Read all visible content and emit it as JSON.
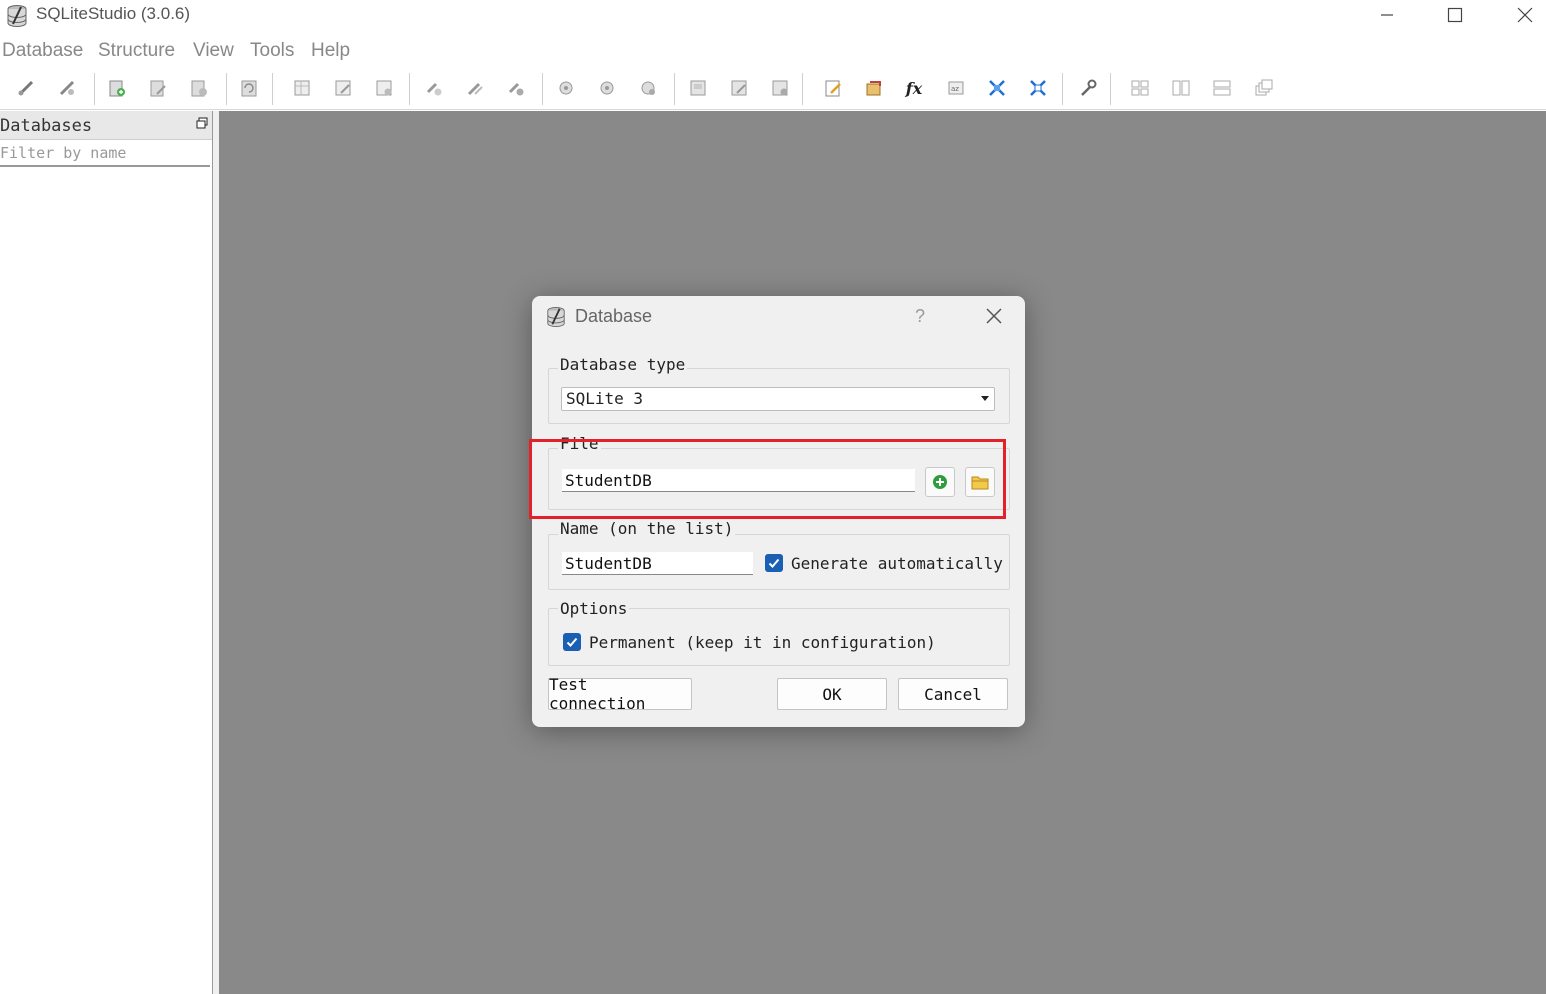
{
  "window": {
    "title": "SQLiteStudio (3.0.6)",
    "icon": "sqlite-database-icon"
  },
  "menu": [
    "Database",
    "Structure",
    "View",
    "Tools",
    "Help"
  ],
  "toolbar": {
    "icons": [
      "connect-icon",
      "disconnect-icon",
      "add-database-icon",
      "edit-database-icon",
      "delete-database-icon",
      "refresh-icon",
      "add-table-icon",
      "edit-table-icon",
      "delete-table-icon",
      "add-index-icon",
      "edit-index-icon",
      "delete-index-icon",
      "add-trigger-icon",
      "edit-trigger-icon",
      "delete-trigger-icon",
      "add-view-icon",
      "edit-view-icon",
      "delete-view-icon",
      "sql-editor-icon",
      "import-icon",
      "functions-icon",
      "collations-icon",
      "extensions-icon",
      "config-icon",
      "settings-icon",
      "tile-icon",
      "tile-horizontal-icon",
      "tile-vertical-icon",
      "cascade-icon"
    ]
  },
  "dock": {
    "title": "Databases",
    "filter_placeholder": "Filter by name"
  },
  "dialog": {
    "title": "Database",
    "help": "?",
    "database_type": {
      "label": "Database type",
      "value": "SQLite 3"
    },
    "file": {
      "label": "File",
      "value": "StudentDB"
    },
    "name": {
      "label": "Name (on the list)",
      "value": "StudentDB",
      "generate_label": "Generate automatically",
      "generate_checked": true
    },
    "options": {
      "label": "Options",
      "permanent_label": "Permanent (keep it in configuration)",
      "permanent_checked": true
    },
    "buttons": {
      "test": "Test connection",
      "ok": "OK",
      "cancel": "Cancel"
    }
  },
  "colors": {
    "mdi_background": "#898989",
    "checkbox": "#1a5fb4",
    "highlight": "#e3212b"
  }
}
